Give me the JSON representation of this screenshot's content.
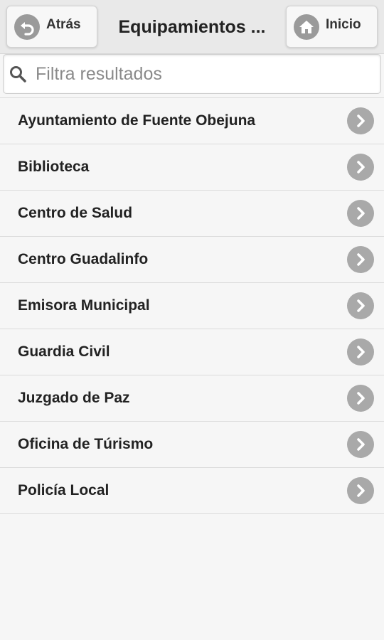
{
  "header": {
    "back_label": "Atrás",
    "title": "Equipamientos ...",
    "home_label": "Inicio"
  },
  "search": {
    "placeholder": "Filtra resultados",
    "value": ""
  },
  "list": {
    "items": [
      {
        "label": "Ayuntamiento de Fuente Obejuna"
      },
      {
        "label": "Biblioteca"
      },
      {
        "label": "Centro de Salud"
      },
      {
        "label": "Centro Guadalinfo"
      },
      {
        "label": "Emisora Municipal"
      },
      {
        "label": "Guardia Civil"
      },
      {
        "label": "Juzgado de Paz"
      },
      {
        "label": "Oficina de Túrismo"
      },
      {
        "label": "Policía Local"
      }
    ]
  },
  "icons": {
    "back": "arrow-left-icon",
    "home": "home-icon",
    "search": "search-icon",
    "item_arrow": "chevron-right-icon"
  },
  "colors": {
    "background": "#f6f6f6",
    "header": "#e9e9e9",
    "icon_circle": "#9a9a9a",
    "text": "#222222"
  }
}
